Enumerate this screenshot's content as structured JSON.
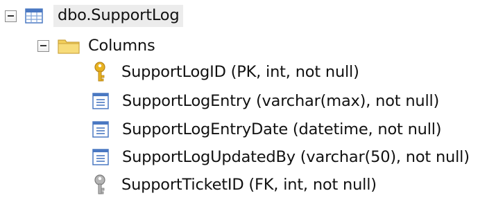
{
  "tree": {
    "table": {
      "label": "dbo.SupportLog",
      "icon": "table-icon",
      "expanded": true,
      "selected": true
    },
    "columns_folder": {
      "label": "Columns",
      "icon": "folder-icon",
      "expanded": true
    },
    "columns": [
      {
        "label": "SupportLogID (PK, int, not null)",
        "icon": "primary-key-icon"
      },
      {
        "label": "SupportLogEntry (varchar(max), not null)",
        "icon": "column-icon"
      },
      {
        "label": "SupportLogEntryDate (datetime, not null)",
        "icon": "column-icon"
      },
      {
        "label": "SupportLogUpdatedBy (varchar(50), not null)",
        "icon": "column-icon"
      },
      {
        "label": "SupportTicketID (FK, int, not null)",
        "icon": "foreign-key-icon"
      }
    ]
  },
  "colors": {
    "selection_bg": "#ececec",
    "icon_blue": "#4a78c2",
    "folder_yellow": "#f2cf5b",
    "key_gold": "#e8b321",
    "key_gray": "#9a9a9a"
  }
}
